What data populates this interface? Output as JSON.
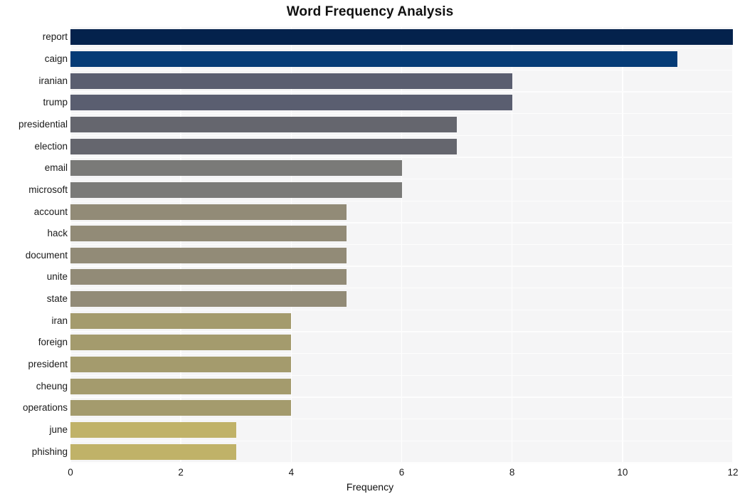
{
  "chart_data": {
    "type": "bar",
    "orientation": "horizontal",
    "title": "Word Frequency Analysis",
    "xlabel": "Frequency",
    "ylabel": "",
    "xlim": [
      0,
      12
    ],
    "xticks": [
      0,
      2,
      4,
      6,
      8,
      10,
      12
    ],
    "grid": true,
    "legend": null,
    "categories": [
      "report",
      "caign",
      "iranian",
      "trump",
      "presidential",
      "election",
      "email",
      "microsoft",
      "account",
      "hack",
      "document",
      "unite",
      "state",
      "iran",
      "foreign",
      "president",
      "cheung",
      "operations",
      "june",
      "phishing"
    ],
    "values": [
      12,
      11,
      8,
      8,
      7,
      7,
      6,
      6,
      5,
      5,
      5,
      5,
      5,
      4,
      4,
      4,
      4,
      4,
      3,
      3
    ],
    "bar_colors": [
      "#04224c",
      "#053b76",
      "#5a5e70",
      "#5a5e70",
      "#65666e",
      "#65666e",
      "#7a7a78",
      "#7a7a78",
      "#928b77",
      "#928b77",
      "#928b77",
      "#928b77",
      "#928b77",
      "#a49b6d",
      "#a49b6d",
      "#a49b6d",
      "#a49b6d",
      "#a49b6d",
      "#c0b268",
      "#c0b268"
    ]
  },
  "style": {
    "plot_background": "#f5f5f6",
    "figure_background": "#ffffff",
    "gridline_color": "#ffffff",
    "text_color": "#1a1a1a"
  }
}
